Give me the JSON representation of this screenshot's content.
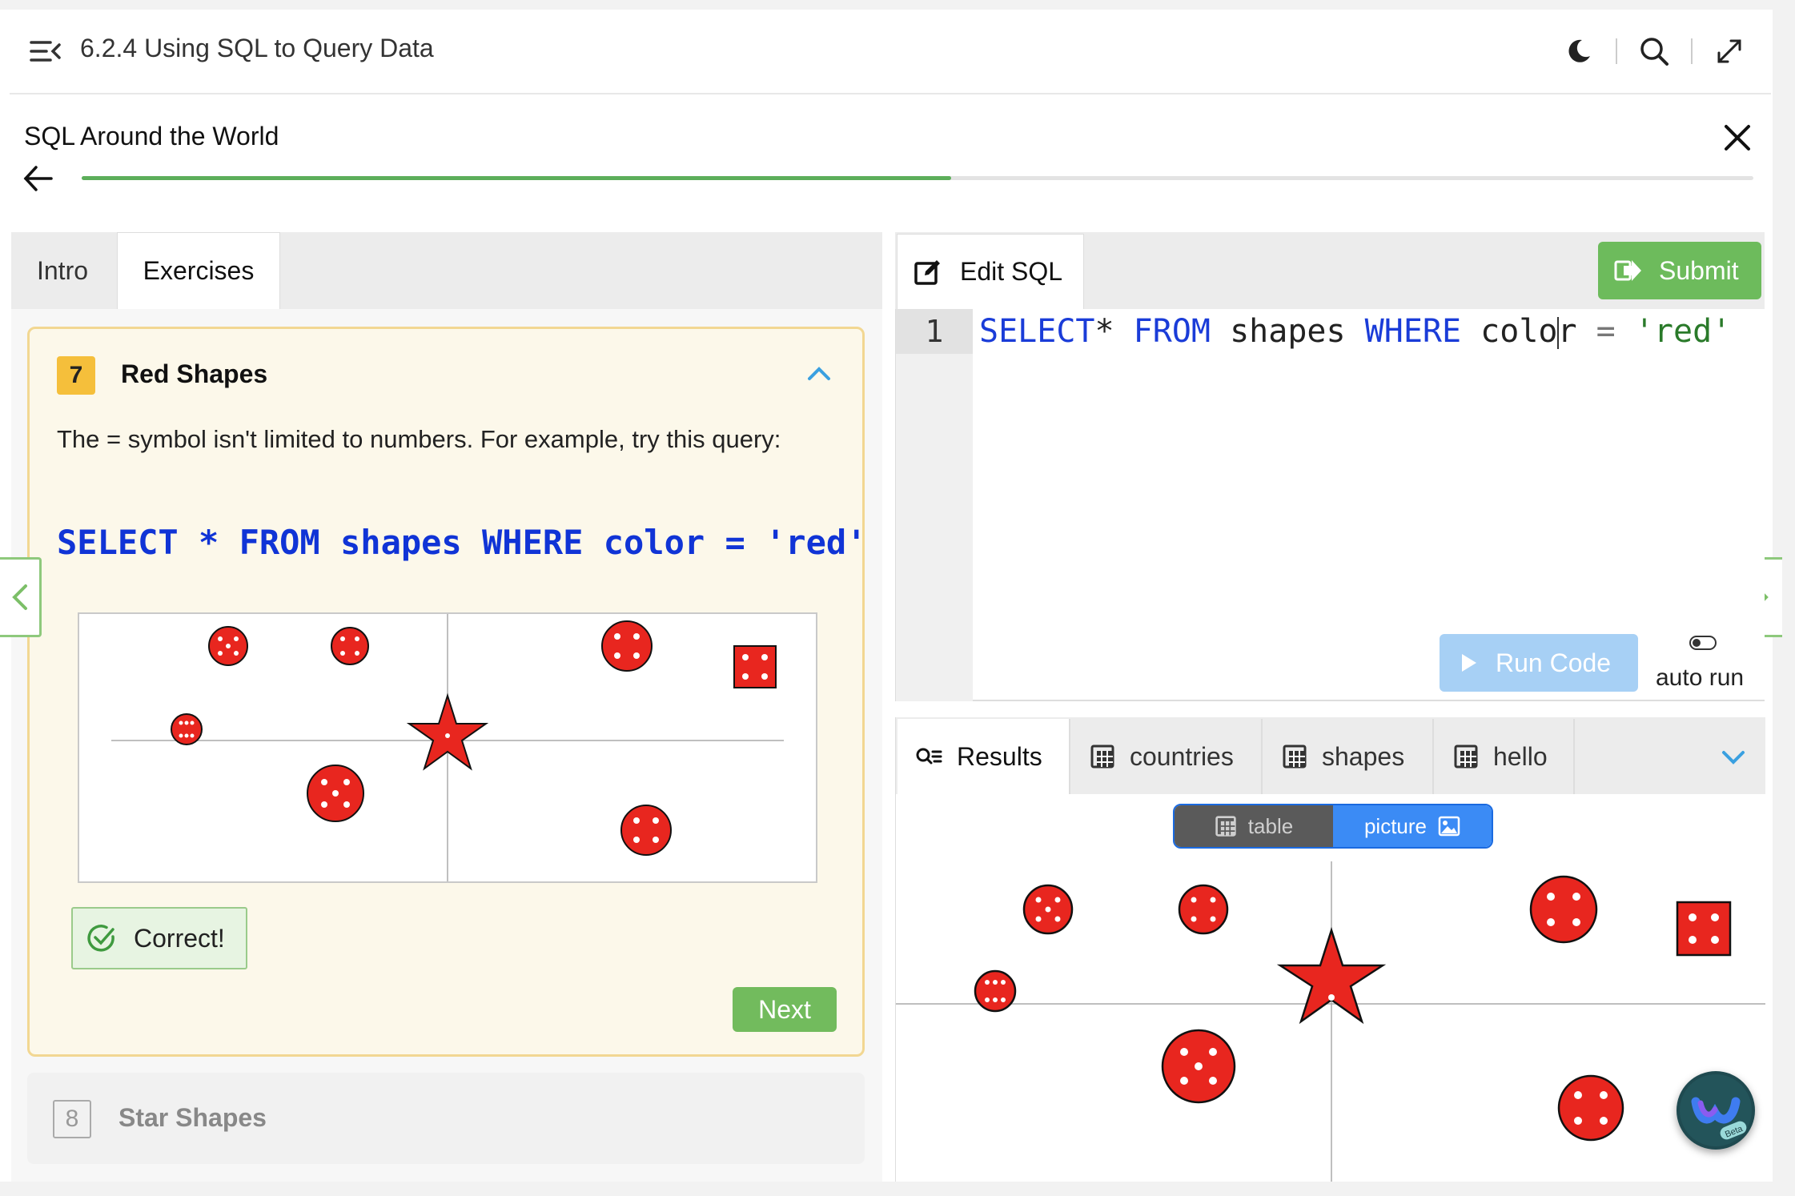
{
  "topbar": {
    "title": "6.2.4 Using SQL to Query Data",
    "icons": [
      "menu-collapse-icon",
      "moon-icon",
      "search-icon",
      "expand-icon"
    ]
  },
  "activity": {
    "title": "SQL Around the World",
    "progress_fraction": 0.52
  },
  "left_tabs": [
    "Intro",
    "Exercises"
  ],
  "exercise": {
    "number": "7",
    "title": "Red Shapes",
    "text": "The = symbol isn't limited to numbers. For example, try this query:",
    "code": "SELECT * FROM shapes WHERE color = 'red'",
    "correct_label": "Correct!",
    "next_label": "Next"
  },
  "next_exercise": {
    "number": "8",
    "title": "Star Shapes"
  },
  "editor": {
    "tab_label": "Edit SQL",
    "submit_label": "Submit",
    "line_number": "1",
    "code_tokens": [
      {
        "t": "SELECT",
        "c": "kw"
      },
      {
        "t": "* ",
        "c": ""
      },
      {
        "t": "FROM",
        "c": "kw"
      },
      {
        "t": " shapes ",
        "c": ""
      },
      {
        "t": "WHERE",
        "c": "kw"
      },
      {
        "t": " colo",
        "c": ""
      },
      {
        "t": "|",
        "c": "cursor"
      },
      {
        "t": "r ",
        "c": ""
      },
      {
        "t": "=",
        "c": "op"
      },
      {
        "t": " 'red'",
        "c": "str"
      }
    ],
    "run_label": "Run Code",
    "auto_run_label": "auto run"
  },
  "results": {
    "tabs": [
      {
        "label": "Results",
        "icon": "results-icon"
      },
      {
        "label": "countries",
        "icon": "table-icon"
      },
      {
        "label": "shapes",
        "icon": "table-icon"
      },
      {
        "label": "hello",
        "icon": "table-icon"
      }
    ],
    "view_table_label": "table",
    "view_picture_label": "picture"
  },
  "colors": {
    "shape_red": "#e8261f",
    "accent_green": "#6dbb5c",
    "accent_blue": "#3b8bf5",
    "keyword_blue": "#1a3cd8"
  }
}
